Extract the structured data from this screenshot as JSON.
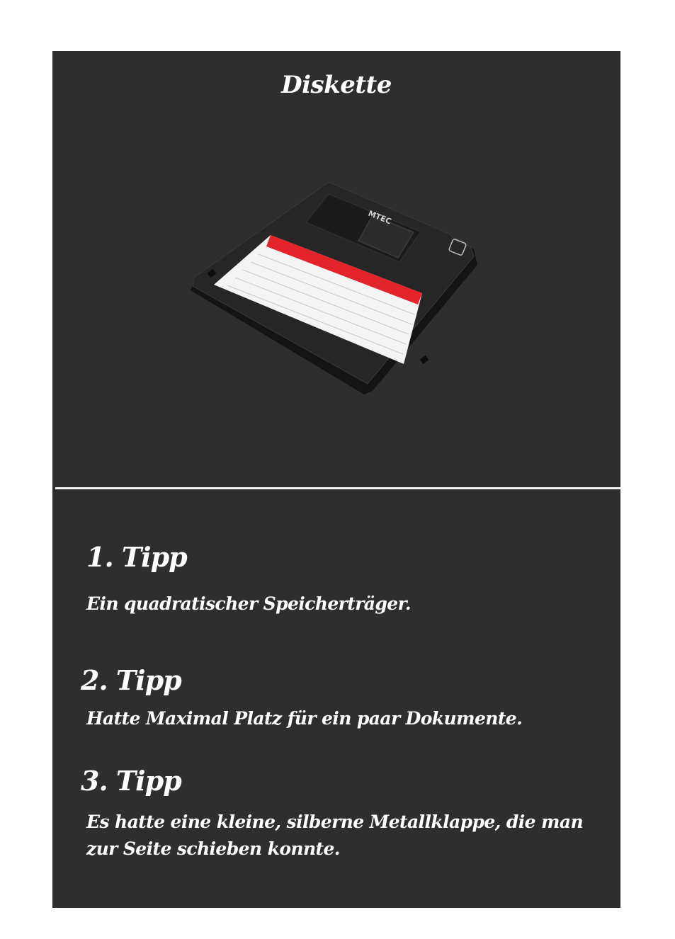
{
  "card": {
    "title": "Diskette"
  },
  "image": {
    "subject": "floppy-disk",
    "label_text": "MTEC",
    "colors": {
      "disk_body": "#1f1f1f",
      "label_stripe": "#e3242b",
      "label_paper": "#f4f4f4",
      "card_background": "#2e2e2e",
      "text": "#ffffff"
    }
  },
  "tips": [
    {
      "heading": "1. Tipp",
      "text": "Ein quadratischer Speicherträger."
    },
    {
      "heading": "2. Tipp",
      "text": "Hatte Maximal Platz für ein paar Dokumente."
    },
    {
      "heading": "3. Tipp",
      "text": "Es hatte eine kleine, silberne Metallklappe, die man zur Seite schieben konnte."
    }
  ]
}
